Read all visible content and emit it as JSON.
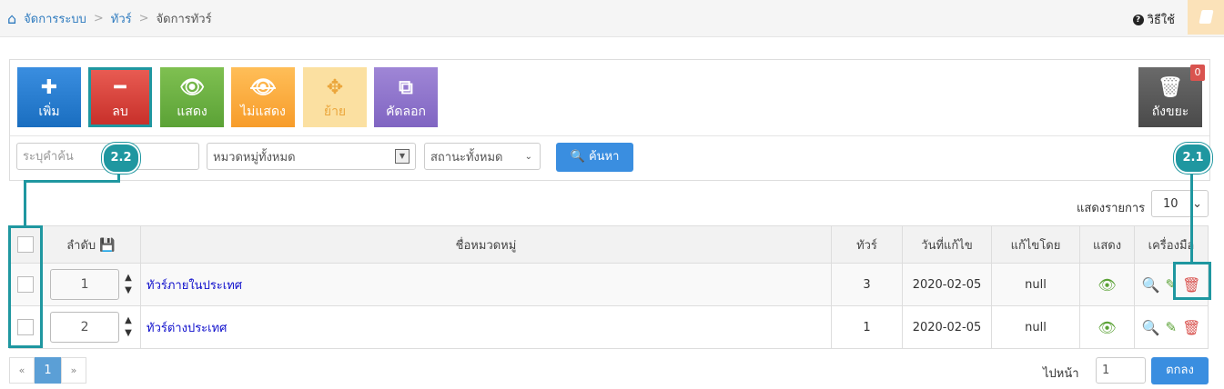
{
  "breadcrumb": {
    "home": "จัดการระบบ",
    "sep": ">",
    "section": "ทัวร์",
    "current": "จัดการทัวร์"
  },
  "header": {
    "help": "วิธีใช้"
  },
  "toolbar": {
    "add": "เพิ่ม",
    "delete": "ลบ",
    "show": "แสดง",
    "hide": "ไม่แสดง",
    "move": "ย้าย",
    "copy": "คัดลอก",
    "trash": "ถังขยะ",
    "trash_count": "0"
  },
  "filters": {
    "search_placeholder": "ระบุคำค้น",
    "category": "หมวดหมู่ทั้งหมด",
    "status": "สถานะทั้งหมด",
    "search_button": "ค้นหา"
  },
  "list": {
    "show_label": "แสดงรายการ",
    "per_page": "10"
  },
  "table": {
    "headers": {
      "seq": "ลำดับ",
      "name": "ชื่อหมวดหมู่",
      "tours": "ทัวร์",
      "date": "วันที่แก้ไข",
      "by": "แก้ไขโดย",
      "show": "แสดง",
      "tools": "เครื่องมือ"
    },
    "rows": [
      {
        "seq": "1",
        "name": "ทัวร์ภายในประเทศ",
        "tours": "3",
        "date": "2020-02-05",
        "by": "null"
      },
      {
        "seq": "2",
        "name": "ทัวร์ต่างประเทศ",
        "tours": "1",
        "date": "2020-02-05",
        "by": "null"
      }
    ]
  },
  "pagination": {
    "prev": "«",
    "page": "1",
    "next": "»",
    "goto_label": "ไปหน้า",
    "goto_value": "1",
    "goto_button": "ตกลง"
  },
  "annotations": {
    "a22": "2.2",
    "a21": "2.1"
  }
}
